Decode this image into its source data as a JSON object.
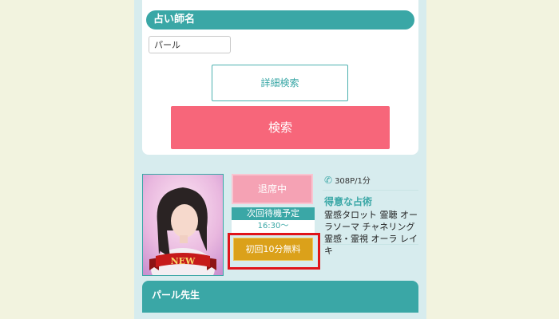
{
  "search_form": {
    "section_title": "占い師名",
    "name_input_value": "パール",
    "detail_search_label": "詳細検索",
    "search_label": "検索"
  },
  "profile": {
    "badge": "NEW",
    "status_label": "退席中",
    "next_standby_label": "次回待機予定",
    "next_standby_time": "16:30〜",
    "free_offer_label": "初回10分無料",
    "price": "308P/1分",
    "specialty_heading": "得意な占術",
    "specialties": "霊感タロット 霊聴 オーラソーマ チャネリング 霊感・霊視 オーラ レイキ",
    "name_bar": "パール先生"
  },
  "colors": {
    "teal": "#3aa7a6",
    "search_pink": "#f7667a",
    "status_pink": "#f5a2b4",
    "gold": "#dba11a",
    "highlight_red": "#e0141a"
  },
  "icons": {
    "price": "phone-icon"
  }
}
